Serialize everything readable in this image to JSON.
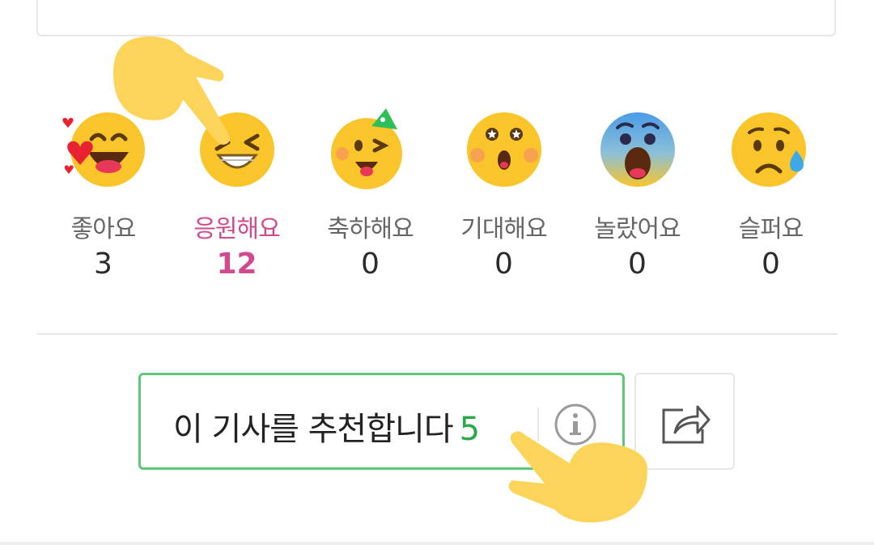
{
  "reactions": [
    {
      "label": "좋아요",
      "count": "3",
      "icon": "love-face-icon"
    },
    {
      "label": "응원해요",
      "count": "12",
      "icon": "cheer-face-icon",
      "active": true
    },
    {
      "label": "축하해요",
      "count": "0",
      "icon": "party-face-icon"
    },
    {
      "label": "기대해요",
      "count": "0",
      "icon": "expect-face-icon"
    },
    {
      "label": "놀랐어요",
      "count": "0",
      "icon": "surprised-face-icon"
    },
    {
      "label": "슬퍼요",
      "count": "0",
      "icon": "sad-face-icon"
    }
  ],
  "recommend": {
    "label": "이 기사를 추천합니다",
    "count": "5",
    "info_icon": "info-icon"
  },
  "share": {
    "icon": "share-icon"
  },
  "colors": {
    "active": "#d14a8f",
    "accent_green": "#2aa84a",
    "border_green": "#5cc97a"
  }
}
